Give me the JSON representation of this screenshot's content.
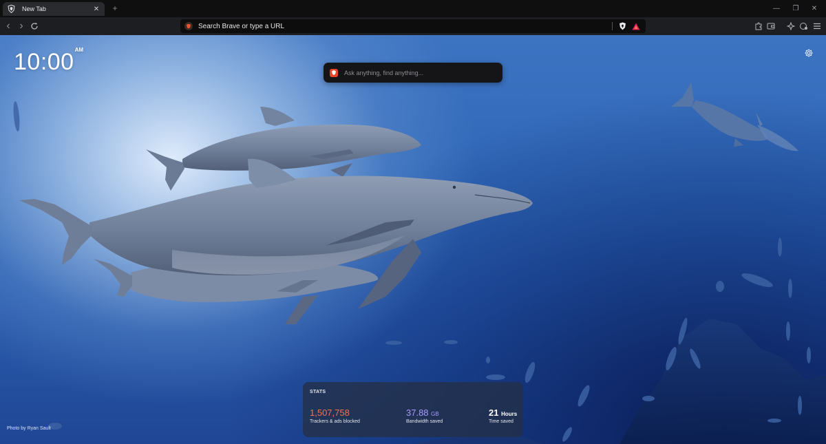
{
  "tab": {
    "title": "New Tab",
    "new_tab": "+"
  },
  "window_controls": {
    "minimize": "—",
    "restore": "❐",
    "close": "✕"
  },
  "toolbar": {
    "back": "‹",
    "forward": "›",
    "omnibox_text": "Search Brave or type a URL"
  },
  "content": {
    "clock": {
      "time": "10:00",
      "ampm": "AM"
    },
    "ask_placeholder": "Ask anything, find anything...",
    "stats": {
      "header": "STATS",
      "trackers": {
        "value": "1,507,758",
        "label": "Trackers & ads blocked"
      },
      "bandwidth": {
        "value": "37.88",
        "unit": "GB",
        "label": "Bandwidth saved"
      },
      "time": {
        "value": "21",
        "unit": "Hours",
        "label": "Time saved"
      }
    },
    "credit": "Photo by Ryan Sault"
  },
  "colors": {
    "trackers": "#f47252",
    "bandwidth": "#a79bfa",
    "brave_orange": "#f0552b",
    "rewards_red": "#e0225a"
  },
  "icons": [
    "brave-shield-icon",
    "close-icon",
    "back-icon",
    "forward-icon",
    "reload-icon",
    "brave-shields-icon",
    "rewards-icon",
    "extensions-icon",
    "wallet-icon",
    "leo-icon",
    "vpn-icon",
    "menu-icon",
    "settings-gear-icon",
    "brave-lion-icon"
  ]
}
